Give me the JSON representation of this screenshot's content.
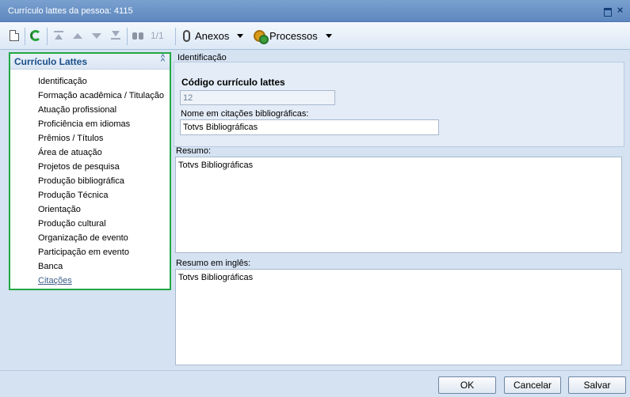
{
  "window": {
    "title": "Currículo lattes da pessoa: 4115"
  },
  "toolbar": {
    "position": "1/1",
    "anexos_label": "Anexos",
    "processos_label": "Processos"
  },
  "sidebar": {
    "title": "Currículo Lattes",
    "items": [
      {
        "label": "Identificação"
      },
      {
        "label": "Formação acadêmica / Titulação"
      },
      {
        "label": "Atuação profissional"
      },
      {
        "label": "Proficiência em idiomas"
      },
      {
        "label": "Prêmios / Títulos"
      },
      {
        "label": "Área de atuação"
      },
      {
        "label": "Projetos de pesquisa"
      },
      {
        "label": "Produção bibliográfica"
      },
      {
        "label": "Produção Técnica"
      },
      {
        "label": "Orientação"
      },
      {
        "label": "Produção cultural"
      },
      {
        "label": "Organização de evento"
      },
      {
        "label": "Participação em evento"
      },
      {
        "label": "Banca"
      },
      {
        "label": "Citações"
      }
    ]
  },
  "form": {
    "section_label": "Identificação",
    "codigo_label": "Código currículo lattes",
    "codigo_value": "12",
    "nome_label": "Nome em citações bibliográficas:",
    "nome_value": "Totvs Bibliográficas",
    "resumo_label": "Resumo:",
    "resumo_value": "Totvs Bibliográficas",
    "resumo_en_label": "Resumo em inglês:",
    "resumo_en_value": "Totvs Bibliográficas"
  },
  "buttons": {
    "ok": "OK",
    "cancelar": "Cancelar",
    "salvar": "Salvar"
  },
  "colors": {
    "highlight_border": "#22a844",
    "titlebar": "#6b92c6",
    "background": "#d5e2f2"
  }
}
